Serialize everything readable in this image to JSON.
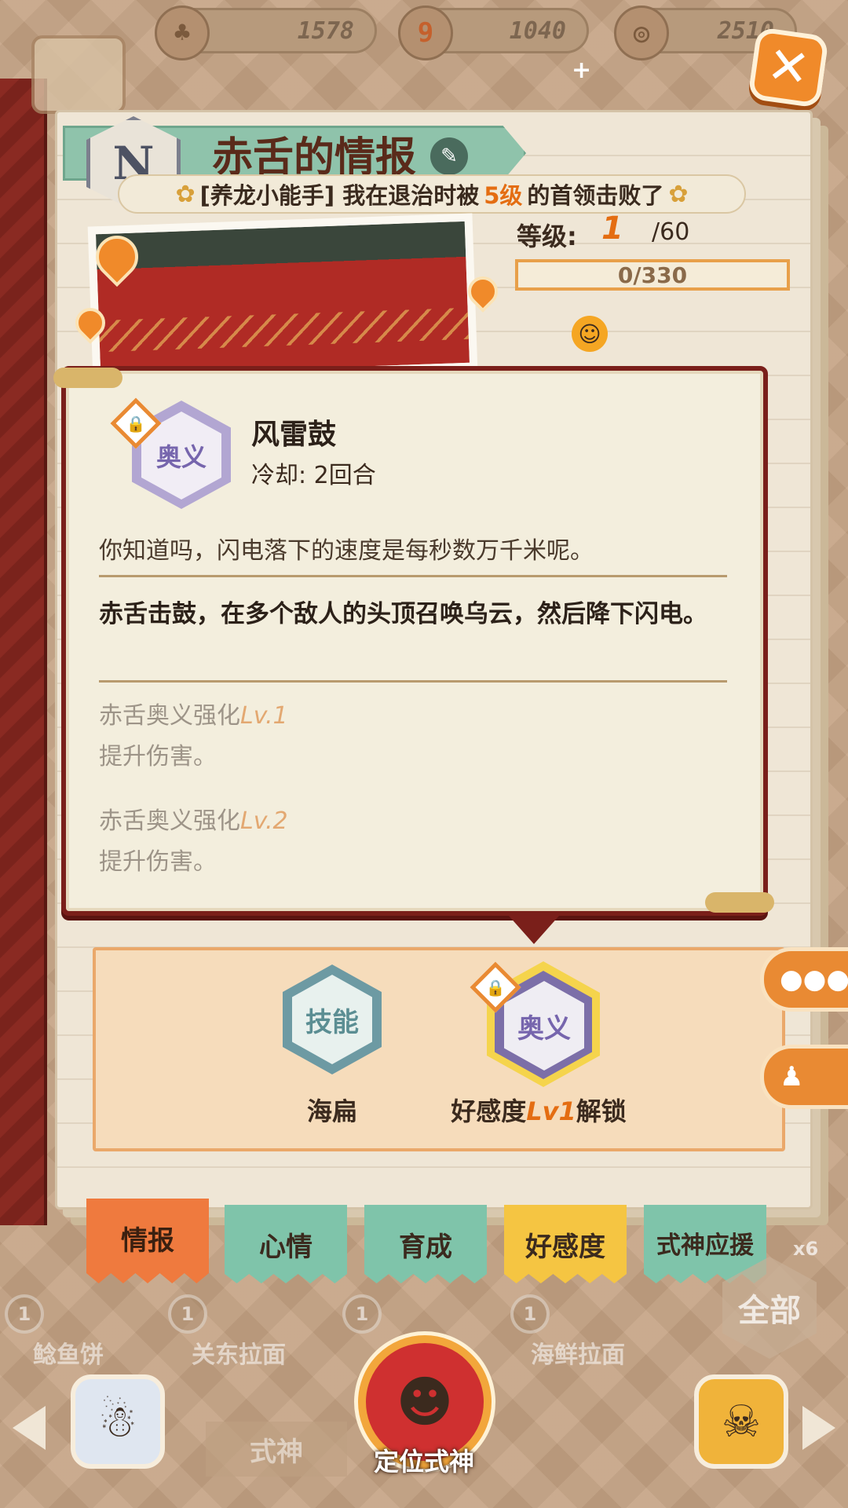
{
  "resources": [
    {
      "icon": "pine-icon",
      "value": "1578"
    },
    {
      "icon": "magatama-icon",
      "value": "1040"
    },
    {
      "icon": "coin-icon",
      "value": "2510"
    }
  ],
  "header": {
    "rank": "N",
    "title": "赤舌的情报",
    "achievement_prefix": "[养龙小能手] 我在退治时被",
    "achievement_highlight": "5级",
    "achievement_suffix": "的首领击败了"
  },
  "level": {
    "label": "等级:",
    "current": "1",
    "max": "/60",
    "exp": "0/330"
  },
  "popup": {
    "skill_type": "奥义",
    "skill_name": "风雷鼓",
    "cooldown": "冷却: 2回合",
    "flavor": "你知道吗，闪电落下的速度是每秒数万千米呢。",
    "description": "赤舌击鼓，在多个敌人的头顶召唤乌云，然后降下闪电。",
    "upgrades": [
      {
        "name": "赤舌奥义强化",
        "level": "Lv.1",
        "effect": "提升伤害。"
      },
      {
        "name": "赤舌奥义强化",
        "level": "Lv.2",
        "effect": "提升伤害。"
      }
    ]
  },
  "skills_panel": {
    "skill1": {
      "badge": "技能",
      "label": "海扁"
    },
    "skill2": {
      "badge": "奥义",
      "label_prefix": "好感度",
      "label_highlight": "Lv1",
      "label_suffix": "解锁"
    }
  },
  "tabs": [
    "情报",
    "心情",
    "育成",
    "好感度",
    "式神应援"
  ],
  "active_tab": "情报",
  "tab_colors": {
    "active": "#ef7a3e",
    "teal": "#7fc4aa",
    "yellow": "#f5c542"
  },
  "food_items": [
    {
      "count": "1",
      "name": "鲶鱼饼"
    },
    {
      "count": "1",
      "name": "关东拉面"
    },
    {
      "count": "1",
      "name": ""
    },
    {
      "count": "1",
      "name": "海鲜拉面"
    }
  ],
  "all_button": "全部",
  "quantity_mark": "x6",
  "bottom_tag": "式神",
  "center_label": "定位式神"
}
